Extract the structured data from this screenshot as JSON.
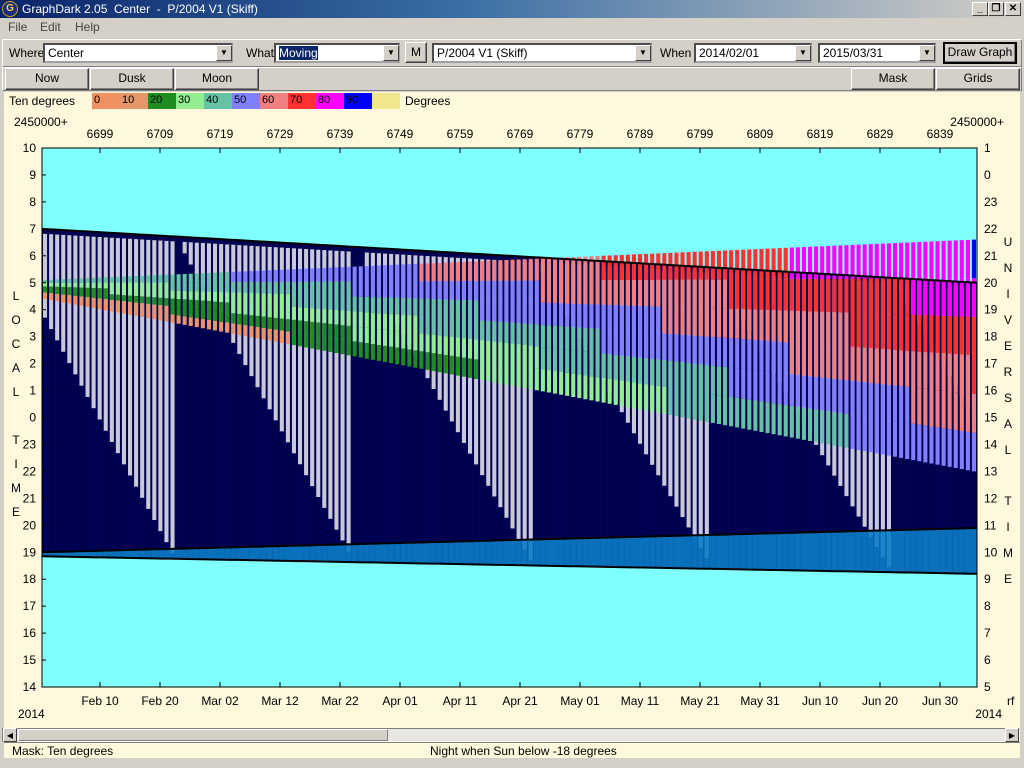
{
  "window": {
    "title": "GraphDark 2.05  Center  -  P/2004 V1 (Skiff)",
    "min_glyph": "_",
    "restore_glyph": "❐",
    "close_glyph": "✕",
    "icon_glyph": "G"
  },
  "menu": [
    {
      "label": "File"
    },
    {
      "label": "Edit"
    },
    {
      "label": "Help"
    }
  ],
  "toolbar": {
    "where_label": "Where",
    "where_value": "Center",
    "what_label": "What",
    "what_value": "Moving",
    "m_button": "M",
    "object_value": "P/2004 V1 (Skiff)",
    "when_label": "When",
    "start_date": "2014/02/01",
    "end_date": "2015/03/31",
    "draw_button": "Draw Graph"
  },
  "buttons": {
    "now": "Now",
    "dusk": "Dusk",
    "moon": "Moon",
    "mask": "Mask",
    "grids": "Grids"
  },
  "legend": {
    "left_label": "Ten degrees",
    "right_label": "Degrees",
    "entries": [
      {
        "label": "0",
        "color": "#f08f60"
      },
      {
        "label": "10",
        "color": "#e8956a"
      },
      {
        "label": "20",
        "color": "#1e8c1e"
      },
      {
        "label": "30",
        "color": "#90ee90"
      },
      {
        "label": "40",
        "color": "#66c2a5"
      },
      {
        "label": "50",
        "color": "#8080ff"
      },
      {
        "label": "60",
        "color": "#f08080"
      },
      {
        "label": "70",
        "color": "#ff3030"
      },
      {
        "label": "80",
        "color": "#ff00ff"
      },
      {
        "label": "90",
        "color": "#0000ff"
      },
      {
        "label": "",
        "color": "#f0e68c"
      }
    ]
  },
  "chart": {
    "jd_prefix_left": "2450000+",
    "jd_prefix_right": "2450000+",
    "jd_ticks": [
      "6699",
      "6709",
      "6719",
      "6729",
      "6739",
      "6749",
      "6759",
      "6769",
      "6779",
      "6789",
      "6799",
      "6809",
      "6819",
      "6829",
      "6839"
    ],
    "left_hours": [
      "10",
      "9",
      "8",
      "7",
      "6",
      "5",
      "4",
      "3",
      "2",
      "1",
      "0",
      "23",
      "22",
      "21",
      "20",
      "19",
      "18",
      "17",
      "16",
      "15",
      "14"
    ],
    "right_hours": [
      "1",
      "0",
      "23",
      "22",
      "21",
      "20",
      "19",
      "18",
      "17",
      "16",
      "15",
      "14",
      "13",
      "12",
      "11",
      "10",
      "9",
      "8",
      "7",
      "6",
      "5"
    ],
    "left_axis_title": [
      "L",
      "O",
      "C",
      "A",
      "L",
      "",
      "T",
      "I",
      "M",
      "E"
    ],
    "right_axis_title_1": [
      "U",
      "N",
      "I",
      "V",
      "E",
      "R",
      "S",
      "A",
      "L"
    ],
    "right_axis_title_2": [
      "T",
      "I",
      "M",
      "E"
    ],
    "date_ticks": [
      "Feb 10",
      "Feb 20",
      "Mar 02",
      "Mar 12",
      "Mar 22",
      "Apr 01",
      "Apr 11",
      "Apr 21",
      "May 01",
      "May 11",
      "May 21",
      "May 31",
      "Jun 10",
      "Jun 20",
      "Jun 30"
    ],
    "year_left": "2014",
    "year_right": "2014",
    "corner_right": "rf"
  },
  "chart_data": {
    "type": "heatmap",
    "x_axis": "date",
    "x_start": "2014-02-01",
    "x_end": "2014-07-05",
    "y_axis": "local time (hours)",
    "y_range": [
      "14:00",
      "10:00 next day"
    ],
    "sunset_local_hour": [
      19.0,
      19.9
    ],
    "sunrise_local_hour": [
      7.0,
      5.0
    ],
    "astro_dusk_local_hour": [
      18.85,
      18.2
    ],
    "colors": {
      "day": "#80ffff",
      "night": "#000050",
      "moon": "#c8c8d8",
      "twilight": "#0a7cc8"
    }
  },
  "status": {
    "left": "Mask:  Ten degrees",
    "center": "Night when Sun below -18 degrees"
  }
}
